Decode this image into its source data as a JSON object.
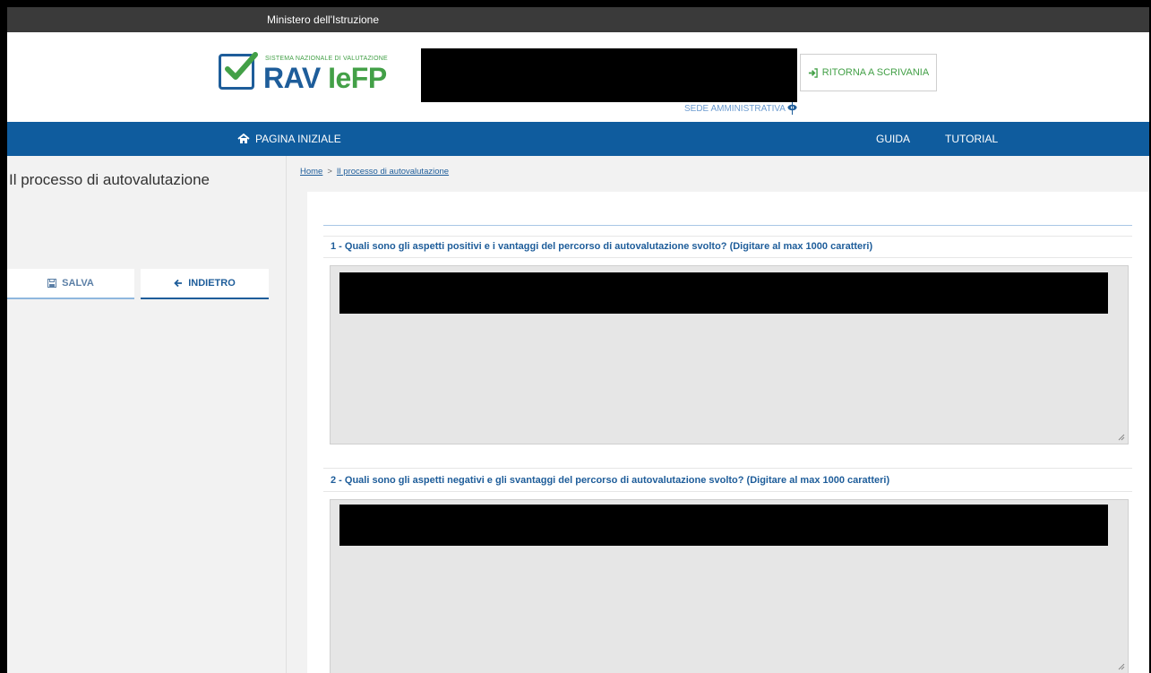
{
  "topbar": {
    "ministry": "Ministero dell'Istruzione"
  },
  "header": {
    "logo_subtitle": "SISTEMA NAZIONALE DI VALUTAZIONE",
    "logo_brand_a": "RAV ",
    "logo_brand_b": "IeFP",
    "return_button": "RITORNA A SCRIVANIA",
    "sede": "SEDE AMMINISTRATIVA"
  },
  "nav": {
    "home": "PAGINA INIZIALE",
    "guida": "GUIDA",
    "tutorial": "TUTORIAL"
  },
  "sidebar": {
    "title": "Il processo di autovalutazione",
    "salva": "SALVA",
    "indietro": "INDIETRO"
  },
  "breadcrumb": {
    "home": "Home",
    "separator": ">",
    "current": "Il processo di autovalutazione"
  },
  "questions": [
    {
      "label": "1 - Quali sono gli aspetti positivi e i vantaggi del percorso di autovalutazione svolto? (Digitare al max 1000 caratteri)"
    },
    {
      "label": "2 - Quali sono gli aspetti negativi e gli svantaggi del percorso di autovalutazione svolto? (Digitare al max 1000 caratteri)"
    }
  ],
  "colors": {
    "nav_blue": "#0f5c9e",
    "brand_green": "#43a047",
    "brand_blue": "#1e5d9a"
  },
  "icons": [
    "home-icon",
    "sign-in-icon",
    "eye-icon",
    "save-icon",
    "arrow-left-icon",
    "resize-grip-icon"
  ]
}
